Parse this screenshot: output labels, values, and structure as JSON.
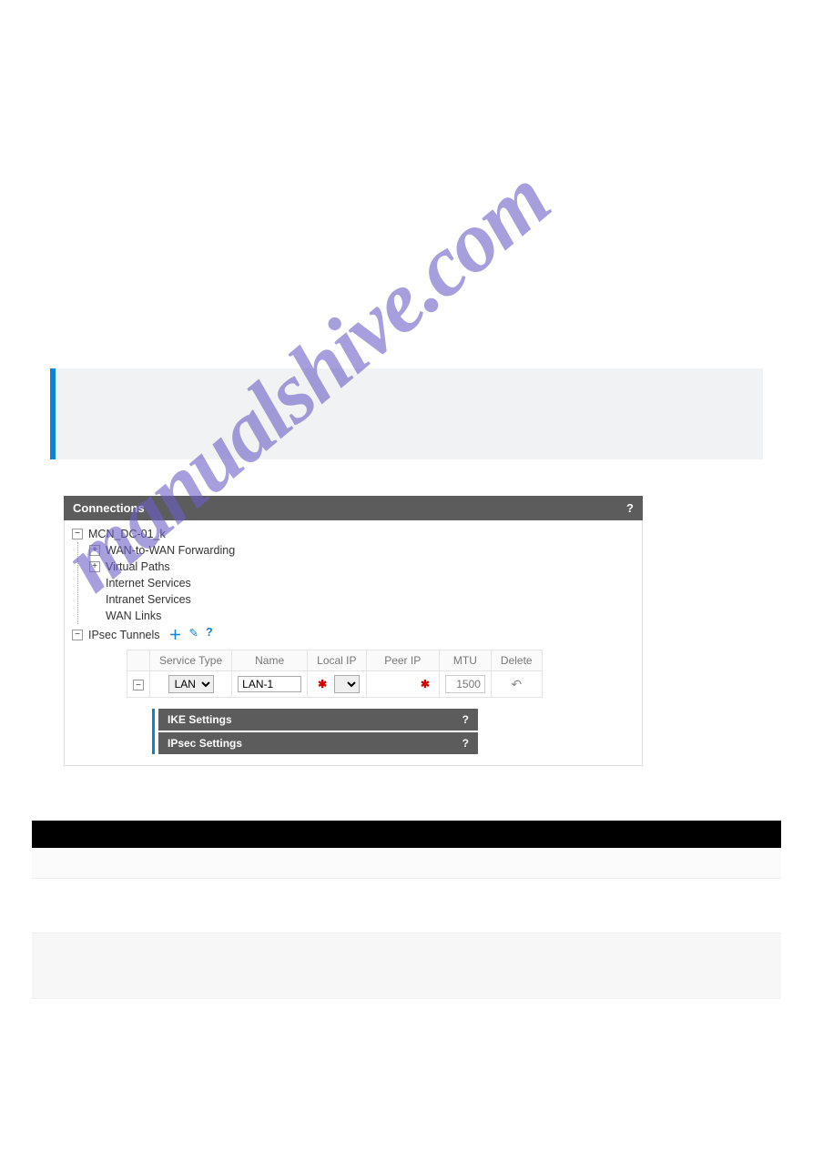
{
  "panel": {
    "title": "Connections",
    "help": "?"
  },
  "tree": {
    "root": "MCN_DC-01_k",
    "items": [
      {
        "label": "WAN-to-WAN Forwarding",
        "expander": "plus"
      },
      {
        "label": "Virtual Paths",
        "expander": "plus"
      },
      {
        "label": "Internet Services",
        "expander": null
      },
      {
        "label": "Intranet Services",
        "expander": null
      },
      {
        "label": "WAN Links",
        "expander": null
      },
      {
        "label": "IPsec Tunnels",
        "expander": "minus",
        "actions": true
      }
    ]
  },
  "subtable": {
    "headers": [
      "",
      "Service Type",
      "Name",
      "Local IP",
      "Peer IP",
      "MTU",
      "Delete"
    ],
    "row": {
      "service_type": "LAN",
      "name": "LAN-1",
      "local_ip": "",
      "peer_ip": "",
      "mtu": "1500"
    }
  },
  "settings": {
    "ike": "IKE Settings",
    "ipsec": "IPsec Settings",
    "help": "?"
  },
  "watermark": "manualshive.com"
}
